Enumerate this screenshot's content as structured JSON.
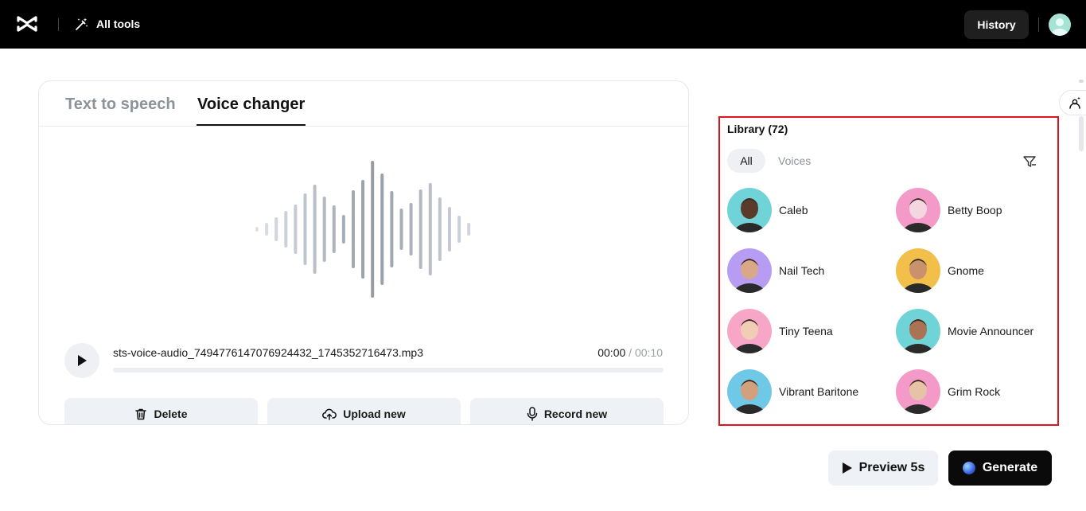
{
  "topbar": {
    "all_tools_label": "All tools",
    "history_label": "History"
  },
  "tabs": {
    "text_to_speech": "Text to speech",
    "voice_changer": "Voice changer",
    "active": "Voice changer"
  },
  "player": {
    "filename": "sts-voice-audio_7494776147076924432_1745352716473.mp3",
    "current_time": "00:00",
    "separator": " / ",
    "duration": "00:10",
    "progress": 0
  },
  "actions": {
    "delete_label": "Delete",
    "upload_label": "Upload new",
    "record_label": "Record new"
  },
  "library": {
    "title": "Library (72)",
    "filters": [
      "All",
      "Voices"
    ],
    "active_filter": "All",
    "voices": [
      {
        "name": "Caleb",
        "avatar_color": "#6fd3d8"
      },
      {
        "name": "Betty Boop",
        "avatar_color": "#f49ac8"
      },
      {
        "name": "Nail Tech",
        "avatar_color": "#b79cf3"
      },
      {
        "name": "Gnome",
        "avatar_color": "#f2c04a"
      },
      {
        "name": "Tiny Teena",
        "avatar_color": "#f7a6c8"
      },
      {
        "name": "Movie Announcer",
        "avatar_color": "#6fd3d8"
      },
      {
        "name": "Vibrant Baritone",
        "avatar_color": "#6fc9e6"
      },
      {
        "name": "Grim Rock",
        "avatar_color": "#f49ac8"
      }
    ]
  },
  "footer": {
    "preview_label": "Preview 5s",
    "generate_label": "Generate"
  },
  "colors": {
    "accent_border": "#e0141e",
    "topbar_bg": "#000000",
    "button_bg": "#eef1f5"
  }
}
